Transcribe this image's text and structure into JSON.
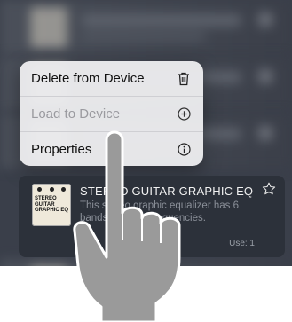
{
  "menu": {
    "items": [
      {
        "label": "Delete from Device",
        "icon": "trash-icon",
        "enabled": true
      },
      {
        "label": "Load to Device",
        "icon": "plus-circle-icon",
        "enabled": false
      },
      {
        "label": "Properties",
        "icon": "info-circle-icon",
        "enabled": true
      }
    ]
  },
  "card": {
    "thumb_label": "STEREO GUITAR GRAPHIC EQ",
    "title": "STEREO GUITAR GRAPHIC EQ",
    "description": "This stereo graphic equalizer has 6 bands at guitar frequencies.",
    "use": "Use: 1",
    "star_icon": "star-outline-icon"
  },
  "colors": {
    "screen_bg": "#3a3f4a",
    "menu_bg": "#ececee",
    "card_bg": "#2c313a",
    "hand_fill": "#9a9a9a",
    "hand_stroke": "#ffffff"
  }
}
